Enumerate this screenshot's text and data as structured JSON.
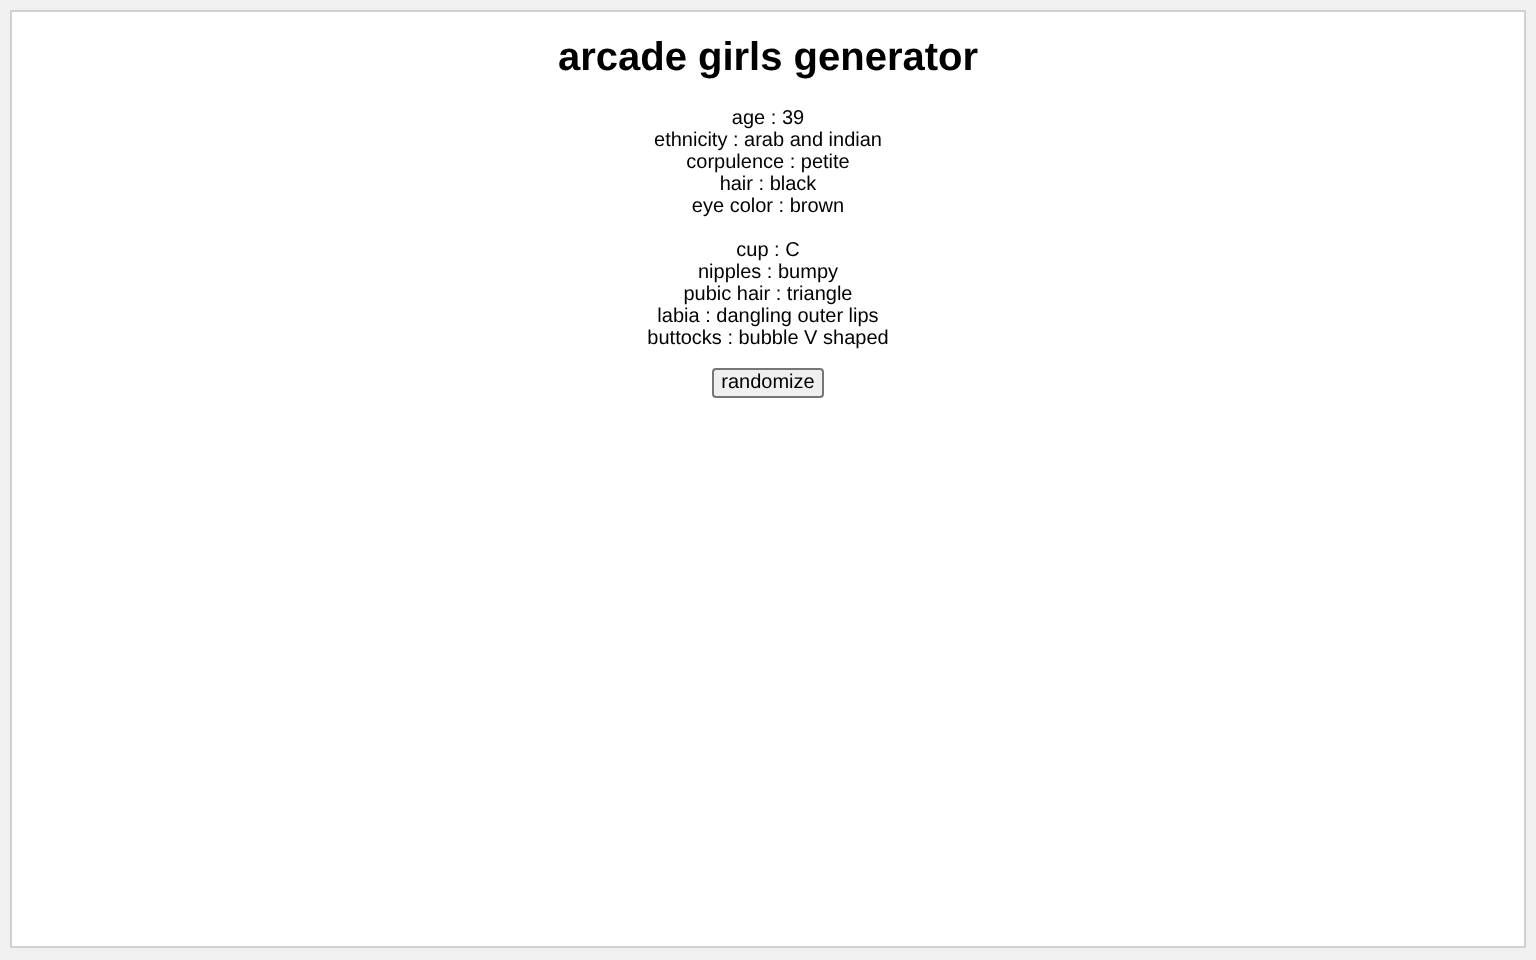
{
  "title": "arcade girls generator",
  "groups": [
    {
      "lines": [
        "age : 39",
        "ethnicity : arab and indian",
        "corpulence : petite",
        "hair : black",
        "eye color : brown"
      ]
    },
    {
      "lines": [
        "cup : C",
        "nipples : bumpy",
        "pubic hair : triangle",
        "labia : dangling outer lips",
        "buttocks : bubble V shaped"
      ]
    }
  ],
  "button": "randomize"
}
